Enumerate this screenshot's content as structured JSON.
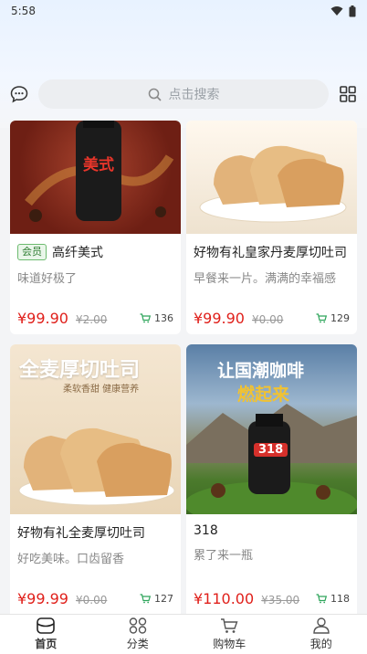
{
  "status": {
    "time": "5:58"
  },
  "header": {
    "search_placeholder": "点击搜索",
    "chat_icon": "chat-bubble-icon",
    "grid_icon": "grid-menu-icon"
  },
  "products": [
    {
      "tag": "会员",
      "title": "高纤美式",
      "desc": "味道好极了",
      "price": "¥99.90",
      "orig": "¥2.00",
      "sales": "136",
      "image_text": "美式"
    },
    {
      "tag": "",
      "title": "好物有礼皇家丹麦厚切吐司",
      "desc": "早餐来一片。满满的幸福感",
      "price": "¥99.90",
      "orig": "¥0.00",
      "sales": "129",
      "image_text": ""
    },
    {
      "tag": "",
      "title": "好物有礼全麦厚切吐司",
      "desc": "好吃美味。口齿留香",
      "price": "¥99.99",
      "orig": "¥0.00",
      "sales": "127",
      "image_text": "全麦厚切吐司",
      "image_subtext": "柔软香甜 健康营养"
    },
    {
      "tag": "",
      "title": "318",
      "desc": "累了来一瓶",
      "price": "¥110.00",
      "orig": "¥35.00",
      "sales": "118",
      "image_text": "让国潮咖啡",
      "image_text2": "燃起来",
      "image_label": "318"
    }
  ],
  "nav": [
    {
      "label": "首页",
      "icon": "home-icon"
    },
    {
      "label": "分类",
      "icon": "category-icon"
    },
    {
      "label": "购物车",
      "icon": "cart-icon"
    },
    {
      "label": "我的",
      "icon": "profile-icon"
    }
  ],
  "colors": {
    "price": "#e0201b",
    "accent": "#2e7d32"
  }
}
